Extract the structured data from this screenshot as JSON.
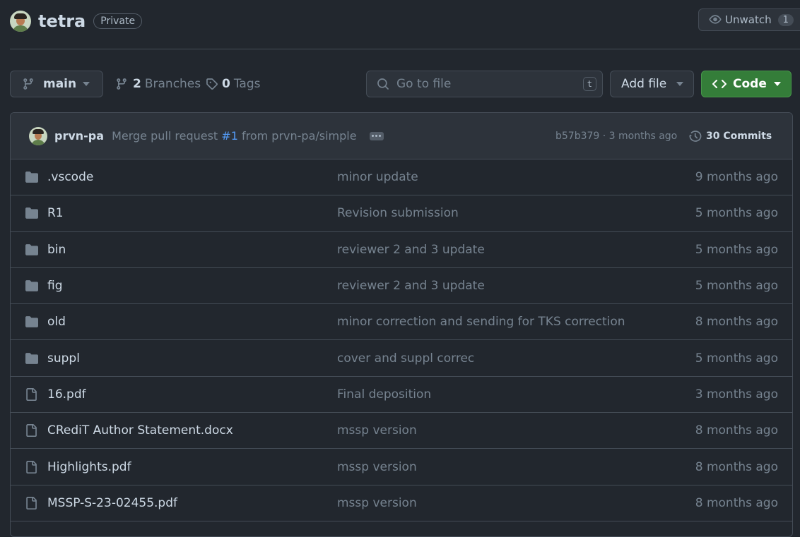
{
  "repo": {
    "name": "tetra",
    "visibility": "Private"
  },
  "watch": {
    "label": "Unwatch",
    "count": "1"
  },
  "toolbar": {
    "branch": "main",
    "branches_count": "2",
    "branches_label": "Branches",
    "tags_count": "0",
    "tags_label": "Tags",
    "goto_placeholder": "Go to file",
    "goto_shortcut": "t",
    "add_file": "Add file",
    "code": "Code"
  },
  "latest_commit": {
    "author": "prvn-pa",
    "message_prefix": "Merge pull request",
    "pr_link": "#1",
    "message_suffix": "from prvn-pa/simple",
    "sha_time": "b57b379 · 3 months ago",
    "commits_label": "30 Commits"
  },
  "files": [
    {
      "type": "folder",
      "name": ".vscode",
      "message": "minor update",
      "date": "9 months ago"
    },
    {
      "type": "folder",
      "name": "R1",
      "message": "Revision submission",
      "date": "5 months ago"
    },
    {
      "type": "folder",
      "name": "bin",
      "message": "reviewer 2 and 3 update",
      "date": "5 months ago"
    },
    {
      "type": "folder",
      "name": "fig",
      "message": "reviewer 2 and 3 update",
      "date": "5 months ago"
    },
    {
      "type": "folder",
      "name": "old",
      "message": "minor correction and sending for TKS correction",
      "date": "8 months ago"
    },
    {
      "type": "folder",
      "name": "suppl",
      "message": "cover and suppl correc",
      "date": "5 months ago"
    },
    {
      "type": "file",
      "name": "16.pdf",
      "message": "Final deposition",
      "date": "3 months ago"
    },
    {
      "type": "file",
      "name": "CRediT Author Statement.docx",
      "message": "mssp version",
      "date": "8 months ago"
    },
    {
      "type": "file",
      "name": "Highlights.pdf",
      "message": "mssp version",
      "date": "8 months ago"
    },
    {
      "type": "file",
      "name": "MSSP-S-23-02455.pdf",
      "message": "mssp version",
      "date": "8 months ago"
    }
  ],
  "colors": {
    "background": "#22272e",
    "accent_green": "#347d39",
    "link": "#539bf5"
  }
}
